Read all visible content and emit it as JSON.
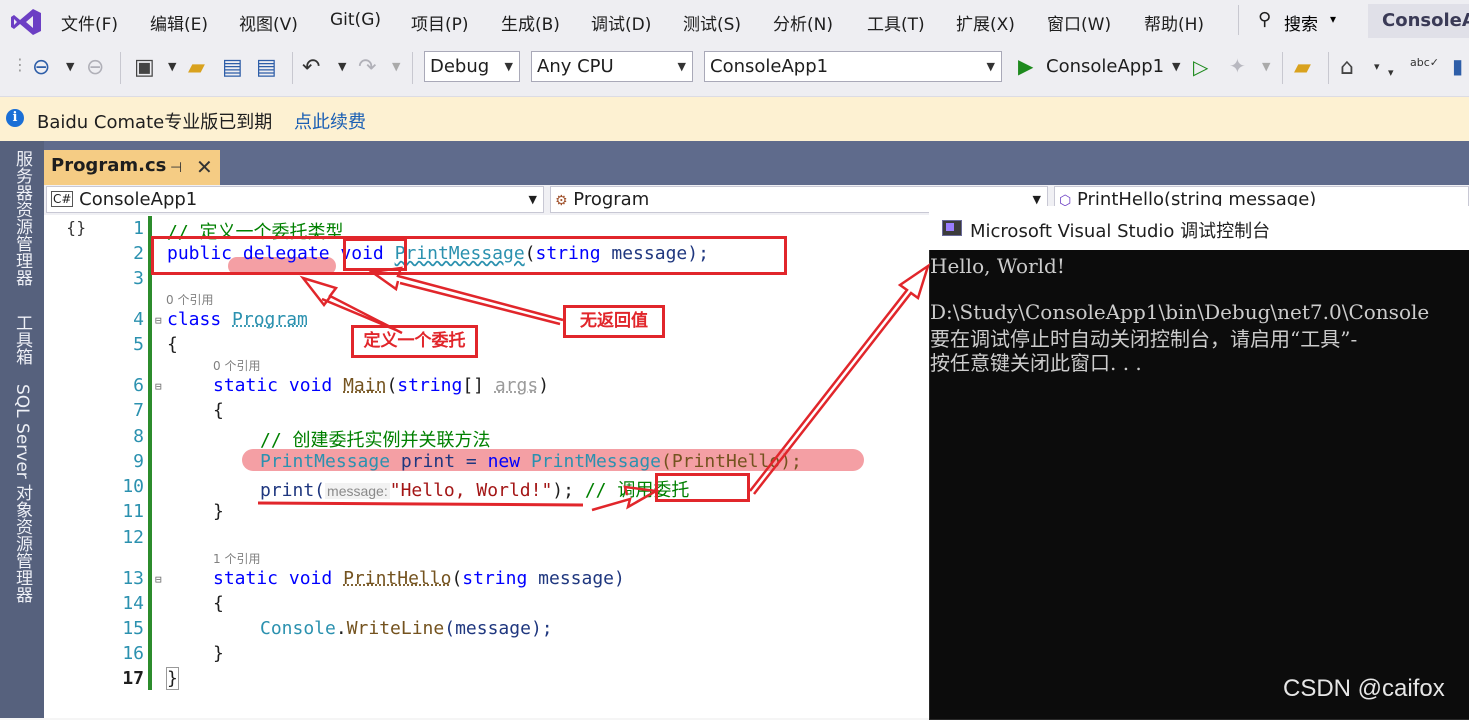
{
  "menu": {
    "items": [
      "文件(F)",
      "编辑(E)",
      "视图(V)",
      "Git(G)",
      "项目(P)",
      "生成(B)",
      "调试(D)",
      "测试(S)",
      "分析(N)",
      "工具(T)",
      "扩展(X)",
      "窗口(W)",
      "帮助(H)"
    ],
    "search_label": "搜索",
    "solution_title": "ConsoleA"
  },
  "toolbar": {
    "configuration": "Debug",
    "platform": "Any CPU",
    "startup_project": "ConsoleApp1",
    "run_label": "ConsoleApp1"
  },
  "infobar": {
    "message": "Baidu Comate专业版已到期",
    "link": "点此续费"
  },
  "sidebar": {
    "tabs": [
      "服务器资源管理器",
      "工具箱",
      "SQL Server 对象资源管理器"
    ]
  },
  "editor": {
    "tab_title": "Program.cs",
    "nav_project": "ConsoleApp1",
    "nav_class": "Program",
    "nav_member": "PrintHello(string message)",
    "line_numbers": [
      "1",
      "2",
      "3",
      "4",
      "5",
      "6",
      "7",
      "8",
      "9",
      "10",
      "11",
      "12",
      "13",
      "14",
      "15",
      "16",
      "17"
    ],
    "codelens": {
      "program": "0 个引用",
      "main": "0 个引用",
      "printhello": "1 个引用"
    },
    "code": {
      "l1_comment": "// 定义一个委托类型",
      "l2_public": "public",
      "l2_delegate": "delegate",
      "l2_void": "void",
      "l2_name": "PrintMessage",
      "l2_open": "(",
      "l2_string": "string",
      "l2_rest": " message);",
      "l4_class": "class",
      "l4_name": "Program",
      "l5": "{",
      "l6_static": "static",
      "l6_void": "void",
      "l6_main": "Main",
      "l6_open": "(",
      "l6_string": "string",
      "l6_brackets": "[] ",
      "l6_args": "args",
      "l6_close": ")",
      "l7": "{",
      "l8_comment": "// 创建委托实例并关联方法",
      "l9_type": "PrintMessage",
      "l9_var": " print = ",
      "l9_new": "new",
      "l9_type2": "PrintMessage",
      "l9_arg": "(PrintHello);",
      "l10_call": "print(",
      "l10_hint": "message:",
      "l10_string": "\"Hello, World!\"",
      "l10_end": "); ",
      "l10_comment": "// 调用委托",
      "l11": "}",
      "l13_static": "static",
      "l13_void": "void",
      "l13_name": "PrintHello",
      "l13_open": "(",
      "l13_string": "string",
      "l13_param": " message)",
      "l14": "{",
      "l15_console": "Console",
      "l15_dot": ".",
      "l15_method": "WriteLine",
      "l15_args": "(message);",
      "l16": "}",
      "l17": "}"
    }
  },
  "console": {
    "title": "Microsoft Visual Studio 调试控制台",
    "lines": [
      "Hello, World!",
      "",
      "D:\\Study\\ConsoleApp1\\bin\\Debug\\net7.0\\Console",
      "要在调试停止时自动关闭控制台，请启用“工具”-",
      "按任意键关闭此窗口. . ."
    ]
  },
  "annotations": {
    "define_delegate": "定义一个委托",
    "no_return": "无返回值",
    "annotation_color": "#e1262b"
  },
  "watermark": "CSDN @caifox"
}
